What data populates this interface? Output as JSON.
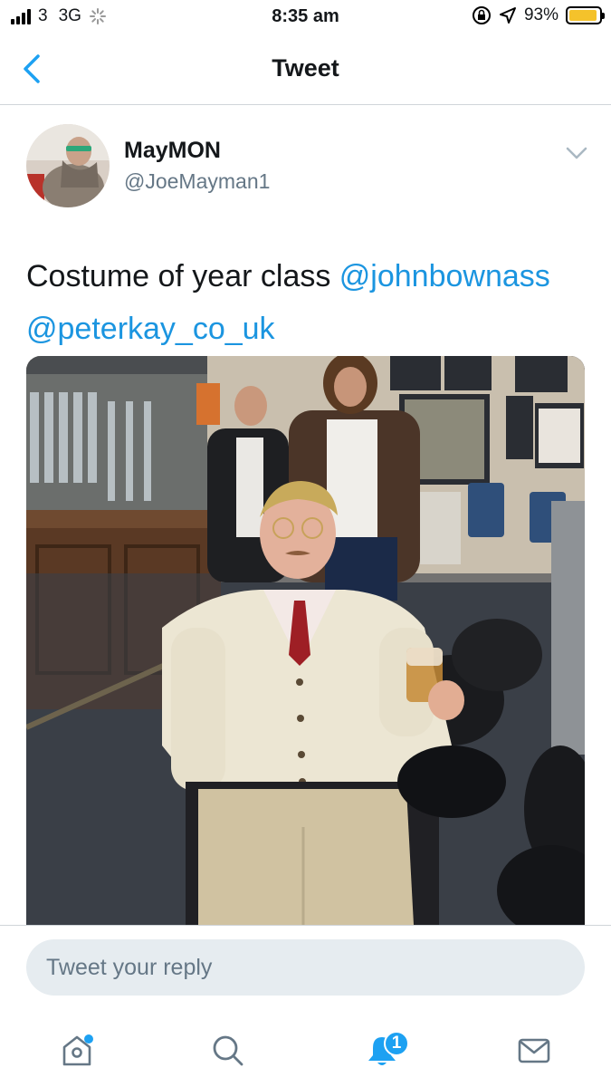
{
  "status_bar": {
    "carrier": "3",
    "network": "3G",
    "time": "8:35 am",
    "battery_percent": "93%",
    "battery_level": 0.93,
    "icons": [
      "signal-icon",
      "loading-spinner-icon",
      "orientation-lock-icon",
      "location-arrow-icon",
      "battery-icon"
    ]
  },
  "nav": {
    "title": "Tweet",
    "back_icon": "chevron-left-icon"
  },
  "tweet": {
    "display_name": "MayMON",
    "handle": "@JoeMayman1",
    "text_plain": "Costume of year class ",
    "mention_1": "@johnbownass",
    "mention_2": "@peterkay_co_uk",
    "menu_icon": "chevron-down-icon"
  },
  "reply": {
    "placeholder": "Tweet your reply"
  },
  "tab_bar": {
    "tabs": [
      {
        "name": "home",
        "icon": "home-icon",
        "has_dot": true
      },
      {
        "name": "search",
        "icon": "search-icon"
      },
      {
        "name": "notifications",
        "icon": "bell-icon",
        "badge": "1"
      },
      {
        "name": "messages",
        "icon": "envelope-icon"
      }
    ]
  },
  "colors": {
    "accent": "#1da1f2",
    "link": "#1b95e0",
    "secondary_text": "#657786",
    "reply_bg": "#e6ecf0",
    "battery": "#f4c22b"
  }
}
